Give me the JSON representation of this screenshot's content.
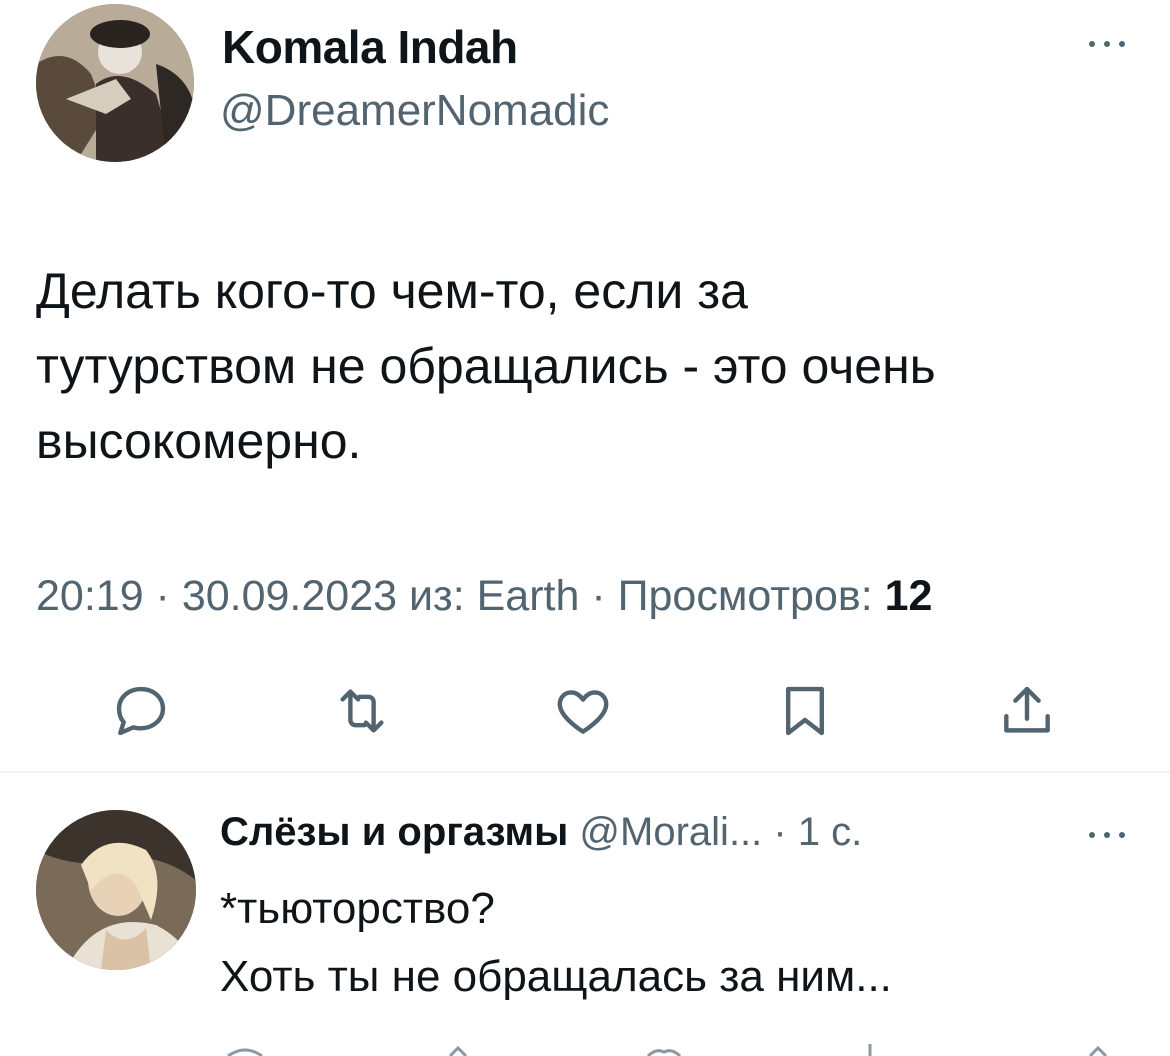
{
  "tweet": {
    "author_name": "Komala Indah",
    "author_handle": "@DreamerNomadic",
    "text_lines": [
      "Делать кого-то чем-то, если за",
      "тутурством не обращались - это очень",
      "высокомерно."
    ],
    "meta_prefix": "20:19 · 30.09.2023 из: Earth · Просмотров: ",
    "views": "12",
    "actions": [
      "reply-icon",
      "retweet-icon",
      "like-icon",
      "bookmark-icon",
      "share-icon"
    ]
  },
  "reply": {
    "author_name": "Слёзы и оргазмы",
    "handle_time": " @Morali... · 1 с.",
    "text_lines": [
      "*тьюторство?",
      "Хоть ты не обращалась за ним..."
    ]
  },
  "colors": {
    "text": "#0f1419",
    "secondary": "#536471",
    "divider": "#eff3f4"
  }
}
